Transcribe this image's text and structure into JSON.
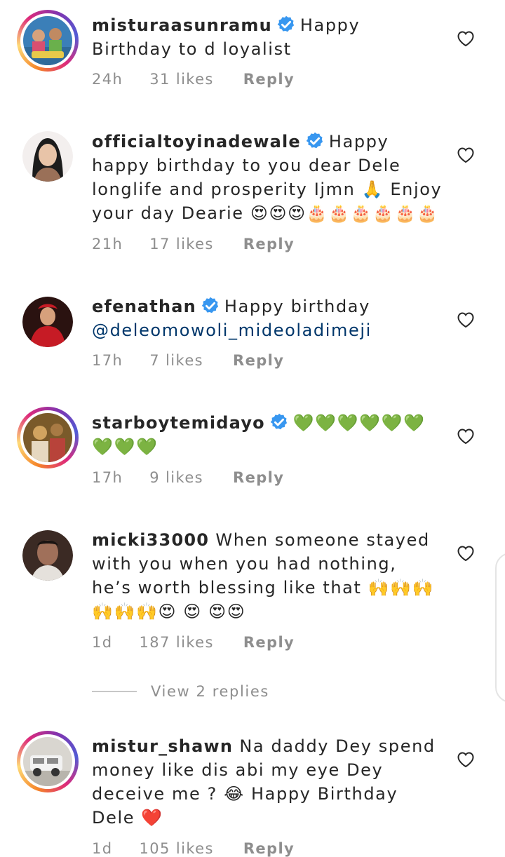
{
  "comments": [
    {
      "username": "misturaasunramu",
      "verified": true,
      "text": "Happy Birthday to d loyalist",
      "time": "24h",
      "likes": "31 likes",
      "reply_label": "Reply",
      "avatar_colors": [
        "#3b7fb8",
        "#e7c94a",
        "#d94f70",
        "#6ab04c"
      ]
    },
    {
      "username": "officialtoyinadewale",
      "verified": true,
      "text": "Happy happy birthday to you dear Dele longlife and prosperity Ijmn 🙏 Enjoy your day Dearie 😍😍😍🎂🎂🎂🎂🎂🎂",
      "time": "21h",
      "likes": "17 likes",
      "reply_label": "Reply",
      "avatar_colors": [
        "#1c1c1c",
        "#e8c4a8",
        "#9a7058"
      ]
    },
    {
      "username": "efenathan",
      "verified": true,
      "text": "Happy birthday",
      "mention": "@deleomowoli_mideoladimeji",
      "time": "17h",
      "likes": "7 likes",
      "reply_label": "Reply",
      "avatar_colors": [
        "#2a1210",
        "#c61b25",
        "#d7a07c"
      ]
    },
    {
      "username": "starboytemidayo",
      "verified": true,
      "text": "💚💚💚💚💚💚💚💚💚",
      "time": "17h",
      "likes": "9 likes",
      "reply_label": "Reply",
      "avatar_colors": [
        "#7a5a2a",
        "#d1a460",
        "#b8433a"
      ]
    },
    {
      "username": "micki33000",
      "verified": false,
      "text": "When someone stayed with you when you had nothing, he’s worth blessing like that 🙌🙌🙌🙌🙌🙌😍 😍 😍😍",
      "time": "1d",
      "likes": "187 likes",
      "reply_label": "Reply",
      "avatar_colors": [
        "#3b2a24",
        "#a0705a",
        "#e5e1dc"
      ]
    },
    {
      "username": "mistur_shawn",
      "verified": false,
      "text": "Na daddy Dey spend money like dis abi my eye Dey deceive me ? 😂 Happy Birthday Dele ❤️",
      "time": "1d",
      "likes": "105 likes",
      "reply_label": "Reply",
      "avatar_colors": [
        "#d9d6d0",
        "#8a8a8a",
        "#f2f2f2"
      ]
    }
  ],
  "view_replies": "View 2 replies",
  "icons": {
    "like": "heart-outline-icon",
    "verified": "verified-badge-icon"
  },
  "colors": {
    "text": "#262626",
    "secondary": "#8e8e8e",
    "verified": "#3897f0",
    "mention": "#00376b"
  }
}
